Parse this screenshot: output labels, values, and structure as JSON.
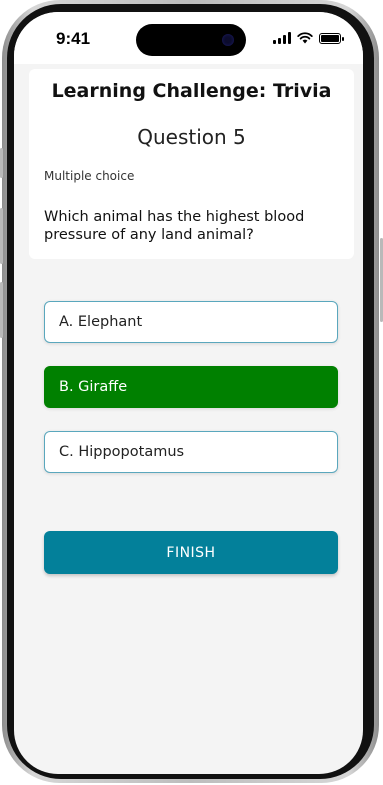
{
  "status_bar": {
    "time": "9:41"
  },
  "header": {
    "title": "Learning Challenge: Trivia"
  },
  "question": {
    "number_label": "Question 5",
    "type_label": "Multiple choice",
    "text": "Which animal has the highest blood pressure of any land animal?"
  },
  "options": [
    {
      "label": "A. Elephant",
      "selected": false
    },
    {
      "label": "B. Giraffe",
      "selected": true
    },
    {
      "label": "C. Hippopotamus",
      "selected": false
    }
  ],
  "actions": {
    "finish_label": "FINISH"
  },
  "colors": {
    "accent": "#03809a",
    "selected": "#008000",
    "option_border": "#5aa7bd",
    "background": "#f4f4f4"
  }
}
